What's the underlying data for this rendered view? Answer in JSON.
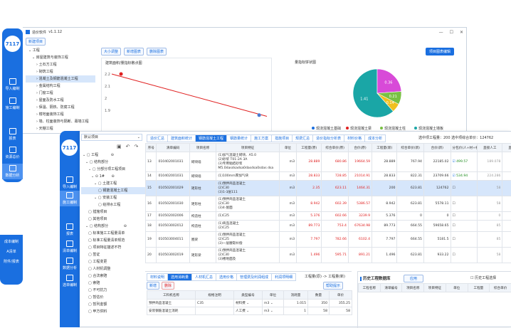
{
  "back": {
    "logo": "7117",
    "title": "造价软件",
    "version": "v1.1.12",
    "nav": [
      "导入编制",
      "施工编制",
      "报表",
      "资源总价",
      "数据分析",
      "反向推导"
    ],
    "action_btn": "新建项目",
    "tree": [
      "工程",
      "房屋建筑与装饰工程",
      "土石方工程",
      "砌筑工程",
      "混凝土及钢筋混凝土工程",
      "金属结构工程",
      "门窗工程",
      "屋面及防水工程",
      "保温、隔热、防腐工程",
      "楼地面装饰工程",
      "墙、柱面装饰与隔断、幕墙工程",
      "天棚工程",
      "油漆、涂料、裱糊工程",
      "其他装饰工程",
      "土建措施项目",
      "单位工程"
    ],
    "buttons": [
      "大小调整",
      "新增图表",
      "删除图表"
    ],
    "right_btn": "项目图表编辑",
    "line_chart_title": "建筑面积/量指标散点图",
    "pie_title": "量指标饼状图",
    "legend": [
      "现浇混凝土基础",
      "现浇混凝土梁",
      "现浇混凝土柱",
      "现浇混凝土墙板"
    ],
    "colors": [
      "#1a6fe0",
      "#e02020",
      "#79c143",
      "#1aa6a6",
      "#f0c020",
      "#d84ad8"
    ]
  },
  "chart_data": [
    {
      "type": "line",
      "title": "建筑面积/量指标散点图",
      "x": [
        0,
        1
      ],
      "y": [
        2.2,
        1.85
      ],
      "yticks": [
        "2.2",
        "2.1",
        "2",
        "1.9"
      ],
      "points": [
        {
          "x": 0.06,
          "y": 2.2
        },
        {
          "x": 0.95,
          "y": 1.86
        }
      ]
    },
    {
      "type": "pie",
      "title": "量指标饼状图",
      "labels": [
        "1.41",
        "0.36",
        "0.21",
        "0.14"
      ],
      "values": [
        60.3,
        23.4,
        8.5,
        5.8
      ],
      "series": [
        "现浇混凝土基础",
        "现浇混凝土梁",
        "现浇混凝土柱",
        "现浇混凝土墙板"
      ]
    }
  ],
  "front": {
    "logo": "7117",
    "title": "造价软件",
    "version": "v1.1.12",
    "nav": [
      "导入编制",
      "施工编制",
      "报表",
      "清单编制",
      "数据分析",
      "选单编制",
      "成本编制",
      "A清单",
      "附件/报表"
    ],
    "project_select": "默认项目",
    "tree": [
      "工程",
      "结构部分",
      "分部分项工程项目",
      "1#",
      "土建工程",
      "钢筋混凝土工程",
      "安装工程",
      "给排水工程",
      "措施项目",
      "其他项目",
      "结构部分",
      "标准施工工程量清单",
      "标准工程量清单规范",
      "项目特征描述不符",
      "签证",
      "工程变更",
      "人材机调整",
      "合法索赔",
      "索赔",
      "不可抗力",
      "暂估价",
      "暂列金额",
      "甲方供料"
    ],
    "top_tabs": [
      "造价汇总",
      "建筑面积统计",
      "钢筋混凝土工程",
      "钢筋量统计",
      "施工方案",
      "措施项目",
      "规费汇总",
      "造价指标分析表",
      "材料价格",
      "成本分析"
    ],
    "summary": "选中项工程量：200  选中项综合单价：124762",
    "headers": [
      "序号",
      "清单编码",
      "项目名称",
      "项目特征",
      "单位",
      "工程量(原)",
      "综合单价(原)",
      "合价(原)",
      "工程量(新)",
      "综合单价(新)",
      "合价(新)",
      "分包价(人+材+机)",
      "直接人工",
      "直接材料",
      "直接机"
    ],
    "rows": [
      [
        "13",
        "010402001031",
        "砌块墙",
        "(1)加气混凝土砌块、A5.0\n(2)砂浆 T01-2A 3A\n(3)专用粘结砂浆\nM5.0dasdsadsa0dasdsa0sdas dsa",
        "m3",
        "28.889",
        "680.86",
        "19664.59",
        "28.889",
        "767.94",
        "22185.02",
        "499.57",
        "189.078",
        "309.19"
      ],
      [
        "14",
        "010402001031",
        "砌块墙",
        "(1)100mm厚加气块",
        "m3",
        "28.833",
        "728.85",
        "21014.91",
        "28.833",
        "822.31",
        "23709.66",
        "534.94",
        "224.286",
        "339.35"
      ],
      [
        "15",
        "010502001029",
        "矩形柱",
        "(1)预拌商品混凝土\n(2)C30\n(3)1-3层111",
        "m3",
        "2.35",
        "623.11",
        "1464.31",
        "200",
        "623.81",
        "124762",
        "",
        "58",
        "355.25"
      ],
      [
        "16",
        "010502001030",
        "矩形柱",
        "(1)预拌商品混凝土\n(2)C30\n(3)4-屋面",
        "m3",
        "8.942",
        "602.39",
        "5386.57",
        "8.942",
        "623.81",
        "5578.11",
        "",
        "58",
        "355.25"
      ],
      [
        "17",
        "010502002006",
        "构造柱",
        "(1)C25",
        "m3",
        "5.376",
        "602.66",
        "3239.9",
        "5.376",
        "0",
        "0",
        "",
        "0",
        "0"
      ],
      [
        "18",
        "010503002012",
        "构造柱",
        "(1)商品混凝土\n(2)C25",
        "m3",
        "89.773",
        "753.4",
        "67634.98",
        "89.773",
        "664.55",
        "59658.65",
        "",
        "85",
        "355.25"
      ],
      [
        "19",
        "010503004011",
        "圈梁",
        "(1)预拌商品混凝土\n(2)C25\n(3)一层腰毂补偿",
        "m3",
        "7.797",
        "782.66",
        "6102.4",
        "7.797",
        "664.55",
        "5181.5",
        "",
        "85",
        "355.25"
      ],
      [
        "20",
        "010503002019",
        "矩形梁",
        "(1)预拌商品混凝土\n(2)C30\n(3)楼地面及",
        "m3",
        "1.496",
        "595.71",
        "891.21",
        "1.496",
        "623.81",
        "933.22",
        "",
        "58",
        "355.25"
      ]
    ],
    "bottom_tabs": [
      "材料说明",
      "选用消耗量",
      "人材机汇总",
      "选用价格",
      "管理费及利润组成",
      "利润项明细"
    ],
    "bottom_path": "工程量(原) -> 工程量(新)",
    "add_btn": "新增",
    "del_btn": "删除",
    "help_btn": "帮助提示",
    "bottom_headers": [
      "工料机名称",
      "规格注明",
      "类型编号",
      "单位",
      "消耗量",
      "数量",
      "单价"
    ],
    "bottom_rows": [
      [
        "预拌商品混凝土",
        "C35",
        "材料费",
        "m3",
        "1.015",
        "350",
        "355.25"
      ],
      [
        "安装钢筋混凝土消耗",
        "",
        "人工费",
        "m3",
        "1",
        "58",
        "58"
      ]
    ],
    "history_title": "历史工程数据库",
    "history_btn": "应用",
    "history_check": "历史工程选择",
    "history_headers": [
      "工程名称",
      "清单编号",
      "项目名称",
      "项目特征",
      "单位",
      "工程量",
      "综合单价"
    ]
  }
}
